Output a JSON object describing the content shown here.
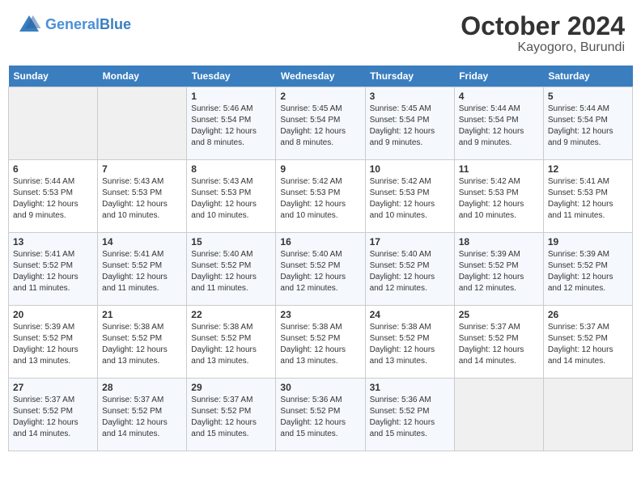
{
  "header": {
    "logo_general": "General",
    "logo_blue": "Blue",
    "month_title": "October 2024",
    "location": "Kayogoro, Burundi"
  },
  "days_of_week": [
    "Sunday",
    "Monday",
    "Tuesday",
    "Wednesday",
    "Thursday",
    "Friday",
    "Saturday"
  ],
  "weeks": [
    [
      {
        "day": "",
        "empty": true
      },
      {
        "day": "",
        "empty": true
      },
      {
        "day": "1",
        "sunrise": "Sunrise: 5:46 AM",
        "sunset": "Sunset: 5:54 PM",
        "daylight": "Daylight: 12 hours and 8 minutes."
      },
      {
        "day": "2",
        "sunrise": "Sunrise: 5:45 AM",
        "sunset": "Sunset: 5:54 PM",
        "daylight": "Daylight: 12 hours and 8 minutes."
      },
      {
        "day": "3",
        "sunrise": "Sunrise: 5:45 AM",
        "sunset": "Sunset: 5:54 PM",
        "daylight": "Daylight: 12 hours and 9 minutes."
      },
      {
        "day": "4",
        "sunrise": "Sunrise: 5:44 AM",
        "sunset": "Sunset: 5:54 PM",
        "daylight": "Daylight: 12 hours and 9 minutes."
      },
      {
        "day": "5",
        "sunrise": "Sunrise: 5:44 AM",
        "sunset": "Sunset: 5:54 PM",
        "daylight": "Daylight: 12 hours and 9 minutes."
      }
    ],
    [
      {
        "day": "6",
        "sunrise": "Sunrise: 5:44 AM",
        "sunset": "Sunset: 5:53 PM",
        "daylight": "Daylight: 12 hours and 9 minutes."
      },
      {
        "day": "7",
        "sunrise": "Sunrise: 5:43 AM",
        "sunset": "Sunset: 5:53 PM",
        "daylight": "Daylight: 12 hours and 10 minutes."
      },
      {
        "day": "8",
        "sunrise": "Sunrise: 5:43 AM",
        "sunset": "Sunset: 5:53 PM",
        "daylight": "Daylight: 12 hours and 10 minutes."
      },
      {
        "day": "9",
        "sunrise": "Sunrise: 5:42 AM",
        "sunset": "Sunset: 5:53 PM",
        "daylight": "Daylight: 12 hours and 10 minutes."
      },
      {
        "day": "10",
        "sunrise": "Sunrise: 5:42 AM",
        "sunset": "Sunset: 5:53 PM",
        "daylight": "Daylight: 12 hours and 10 minutes."
      },
      {
        "day": "11",
        "sunrise": "Sunrise: 5:42 AM",
        "sunset": "Sunset: 5:53 PM",
        "daylight": "Daylight: 12 hours and 10 minutes."
      },
      {
        "day": "12",
        "sunrise": "Sunrise: 5:41 AM",
        "sunset": "Sunset: 5:53 PM",
        "daylight": "Daylight: 12 hours and 11 minutes."
      }
    ],
    [
      {
        "day": "13",
        "sunrise": "Sunrise: 5:41 AM",
        "sunset": "Sunset: 5:52 PM",
        "daylight": "Daylight: 12 hours and 11 minutes."
      },
      {
        "day": "14",
        "sunrise": "Sunrise: 5:41 AM",
        "sunset": "Sunset: 5:52 PM",
        "daylight": "Daylight: 12 hours and 11 minutes."
      },
      {
        "day": "15",
        "sunrise": "Sunrise: 5:40 AM",
        "sunset": "Sunset: 5:52 PM",
        "daylight": "Daylight: 12 hours and 11 minutes."
      },
      {
        "day": "16",
        "sunrise": "Sunrise: 5:40 AM",
        "sunset": "Sunset: 5:52 PM",
        "daylight": "Daylight: 12 hours and 12 minutes."
      },
      {
        "day": "17",
        "sunrise": "Sunrise: 5:40 AM",
        "sunset": "Sunset: 5:52 PM",
        "daylight": "Daylight: 12 hours and 12 minutes."
      },
      {
        "day": "18",
        "sunrise": "Sunrise: 5:39 AM",
        "sunset": "Sunset: 5:52 PM",
        "daylight": "Daylight: 12 hours and 12 minutes."
      },
      {
        "day": "19",
        "sunrise": "Sunrise: 5:39 AM",
        "sunset": "Sunset: 5:52 PM",
        "daylight": "Daylight: 12 hours and 12 minutes."
      }
    ],
    [
      {
        "day": "20",
        "sunrise": "Sunrise: 5:39 AM",
        "sunset": "Sunset: 5:52 PM",
        "daylight": "Daylight: 12 hours and 13 minutes."
      },
      {
        "day": "21",
        "sunrise": "Sunrise: 5:38 AM",
        "sunset": "Sunset: 5:52 PM",
        "daylight": "Daylight: 12 hours and 13 minutes."
      },
      {
        "day": "22",
        "sunrise": "Sunrise: 5:38 AM",
        "sunset": "Sunset: 5:52 PM",
        "daylight": "Daylight: 12 hours and 13 minutes."
      },
      {
        "day": "23",
        "sunrise": "Sunrise: 5:38 AM",
        "sunset": "Sunset: 5:52 PM",
        "daylight": "Daylight: 12 hours and 13 minutes."
      },
      {
        "day": "24",
        "sunrise": "Sunrise: 5:38 AM",
        "sunset": "Sunset: 5:52 PM",
        "daylight": "Daylight: 12 hours and 13 minutes."
      },
      {
        "day": "25",
        "sunrise": "Sunrise: 5:37 AM",
        "sunset": "Sunset: 5:52 PM",
        "daylight": "Daylight: 12 hours and 14 minutes."
      },
      {
        "day": "26",
        "sunrise": "Sunrise: 5:37 AM",
        "sunset": "Sunset: 5:52 PM",
        "daylight": "Daylight: 12 hours and 14 minutes."
      }
    ],
    [
      {
        "day": "27",
        "sunrise": "Sunrise: 5:37 AM",
        "sunset": "Sunset: 5:52 PM",
        "daylight": "Daylight: 12 hours and 14 minutes."
      },
      {
        "day": "28",
        "sunrise": "Sunrise: 5:37 AM",
        "sunset": "Sunset: 5:52 PM",
        "daylight": "Daylight: 12 hours and 14 minutes."
      },
      {
        "day": "29",
        "sunrise": "Sunrise: 5:37 AM",
        "sunset": "Sunset: 5:52 PM",
        "daylight": "Daylight: 12 hours and 15 minutes."
      },
      {
        "day": "30",
        "sunrise": "Sunrise: 5:36 AM",
        "sunset": "Sunset: 5:52 PM",
        "daylight": "Daylight: 12 hours and 15 minutes."
      },
      {
        "day": "31",
        "sunrise": "Sunrise: 5:36 AM",
        "sunset": "Sunset: 5:52 PM",
        "daylight": "Daylight: 12 hours and 15 minutes."
      },
      {
        "day": "",
        "empty": true
      },
      {
        "day": "",
        "empty": true
      }
    ]
  ]
}
